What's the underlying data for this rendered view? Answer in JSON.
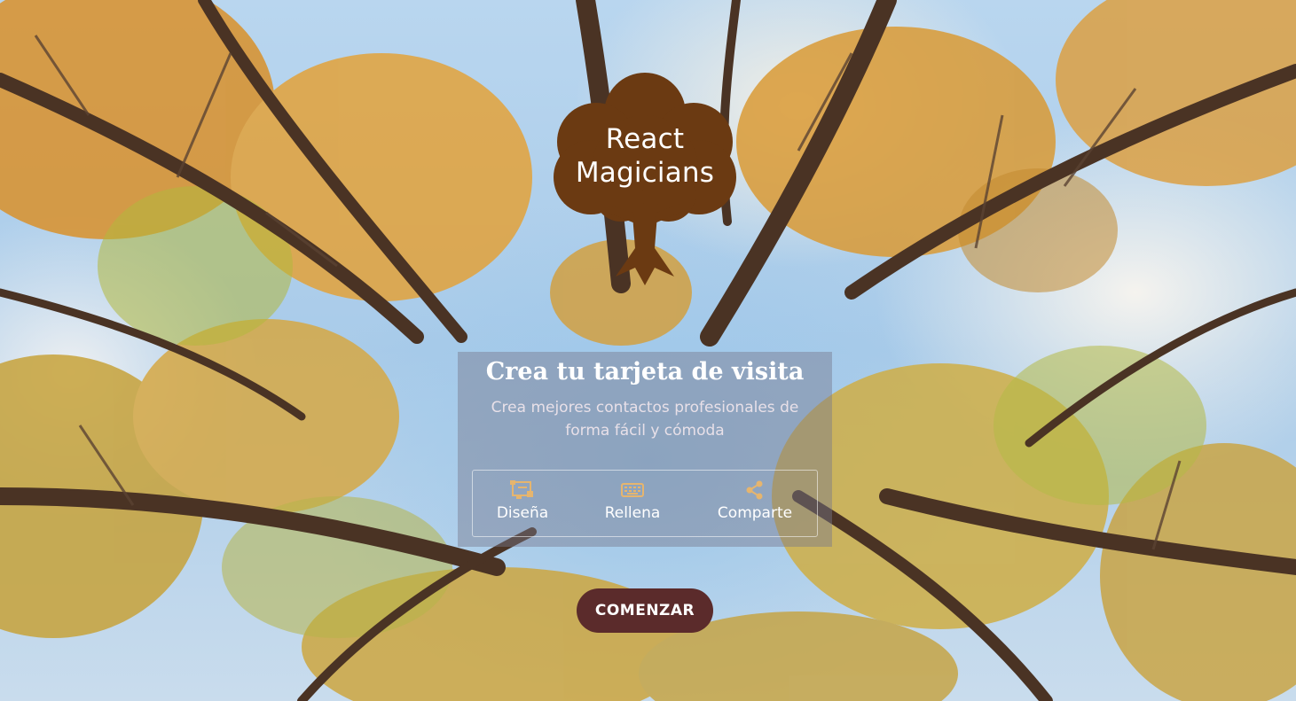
{
  "logo": {
    "line1": "React",
    "line2": "Magicians",
    "color": "#6b3a12"
  },
  "hero": {
    "title": "Crea tu tarjeta de visita",
    "subtitle": "Crea mejores contactos profesionales de forma fácil y cómoda"
  },
  "steps": [
    {
      "label": "Diseña",
      "icon": "layout-icon"
    },
    {
      "label": "Rellena",
      "icon": "keyboard-icon"
    },
    {
      "label": "Comparte",
      "icon": "share-icon"
    }
  ],
  "cta": {
    "label": "COMENZAR",
    "color": "#5b2b2b"
  },
  "colors": {
    "accent": "#e6b56e",
    "card": "rgba(120,120,140,0.45)"
  }
}
